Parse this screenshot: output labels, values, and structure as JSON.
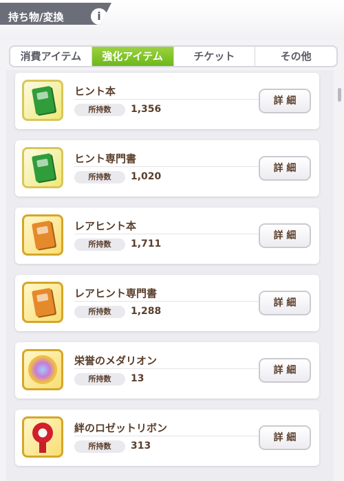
{
  "header": {
    "title": "持ち物/変換",
    "info_icon": "i"
  },
  "tabs": [
    {
      "label": "消費アイテム"
    },
    {
      "label": "強化アイテム"
    },
    {
      "label": "チケット"
    },
    {
      "label": "その他"
    }
  ],
  "items": [
    {
      "name": "ヒント本",
      "count_label": "所持数",
      "count": "1,356",
      "button": "詳 細",
      "icon": "green-book-icon"
    },
    {
      "name": "ヒント専門書",
      "count_label": "所持数",
      "count": "1,020",
      "button": "詳 細",
      "icon": "green-tome-icon"
    },
    {
      "name": "レアヒント本",
      "count_label": "所持数",
      "count": "1,711",
      "button": "詳 細",
      "icon": "orange-book-icon"
    },
    {
      "name": "レアヒント専門書",
      "count_label": "所持数",
      "count": "1,288",
      "button": "詳 細",
      "icon": "orange-tome-icon"
    },
    {
      "name": "栄誉のメダリオン",
      "count_label": "所持数",
      "count": "13",
      "button": "詳 細",
      "icon": "medallion-icon"
    },
    {
      "name": "絆のロゼットリボン",
      "count_label": "所持数",
      "count": "313",
      "button": "詳 細",
      "icon": "rosette-ribbon-icon"
    }
  ],
  "colors": {
    "accent_green": "#7cc229",
    "text_brown": "#5a3e2b"
  }
}
